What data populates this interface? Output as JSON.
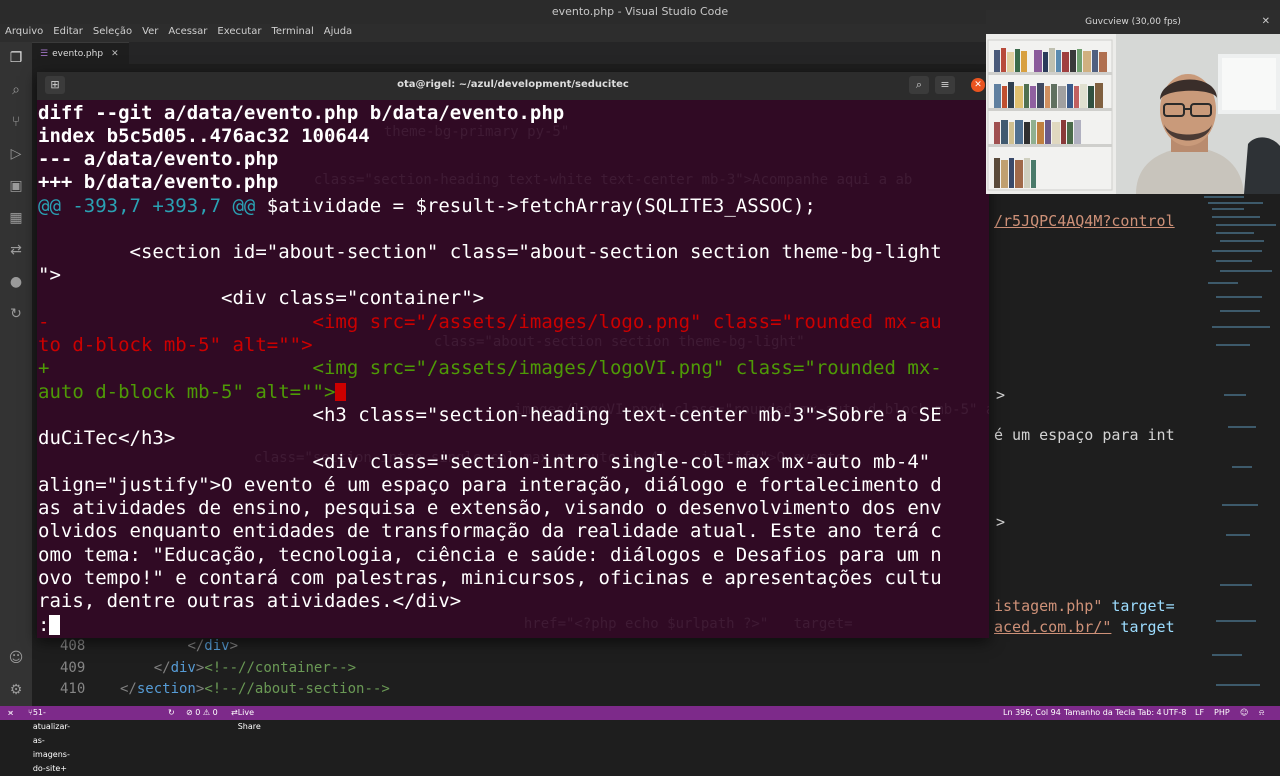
{
  "window": {
    "title": "evento.php - Visual Studio Code"
  },
  "menu": [
    "Arquivo",
    "Editar",
    "Seleção",
    "Ver",
    "Acessar",
    "Executar",
    "Terminal",
    "Ajuda"
  ],
  "tab": {
    "label": "evento.php"
  },
  "editor_lines": [
    {
      "num": "408",
      "indent": "        ",
      "code_open": "</",
      "tag": "div",
      "code_close": ">",
      "comment": ""
    },
    {
      "num": "409",
      "indent": "    ",
      "code_open": "</",
      "tag": "div",
      "code_close": ">",
      "comment": "<!--//container-->"
    },
    {
      "num": "410",
      "indent": "",
      "code_open": "</",
      "tag": "section",
      "code_close": ">",
      "comment": "<!--//about-section-->"
    }
  ],
  "editor_right": {
    "line1": "/r5JQPC4AQ4M?control",
    "line2": "é um espaço para int",
    "line3_a": "istagem.php\"",
    "line3_b": " target=",
    "line4_a": "aced.com.br/\"",
    "line4_b": " target"
  },
  "terminal": {
    "title": "ota@rigel: ~/azul/development/seducitec",
    "lines": {
      "l1": "diff --git a/data/evento.php b/data/evento.php",
      "l2": "index b5c5d05..476ac32 100644",
      "l3": "--- a/data/evento.php",
      "l4": "+++ b/data/evento.php",
      "l5a": "@@ -393,7 +393,7 @@",
      "l5b": " $atividade = $result->fetchArray(SQLITE3_ASSOC);",
      "l6": "        <section id=\"about-section\" class=\"about-section section theme-bg-light",
      "l7": "\">",
      "l8": "                <div class=\"container\">",
      "l9": "-                       <img src=\"/assets/images/logo.png\" class=\"rounded mx-au",
      "l10": "to d-block mb-5\" alt=\"\">",
      "l11a": "+",
      "l11b": "                       <img src=\"/assets/images/logoVI.png\" class=\"rounded mx-",
      "l12": "auto d-block mb-5\" alt=\"\">",
      "l13": "                        <h3 class=\"section-heading text-center mb-3\">Sobre a SE",
      "l14": "duCiTec</h3>",
      "l15": "                        <div class=\"section-intro single-col-max mx-auto mb-4\"",
      "l16": "align=\"justify\">O evento é um espaço para interação, diálogo e fortalecimento d",
      "l17": "as atividades de ensino, pesquisa e extensão, visando o desenvolvimento dos env",
      "l18": "olvidos enquanto entidades de transformação da realidade atual. Este ano terá c",
      "l19": "omo tema: \"Educação, tecnologia, ciência e saúde: diálogos e Desafios para um n",
      "l20": "ovo tempo!\" e contará com palestras, minicursos, oficinas e apresentações cultu",
      "l21": "rais, dentre outras atividades.</div>",
      "l22": ":"
    }
  },
  "webcam": {
    "title": "Guvcview  (30,00 fps)"
  },
  "status": {
    "branch": "51-atualizar-as-imagens-do-site+",
    "problems": "⊘ 0 ⚠ 0",
    "live_share": "Live Share",
    "position": "Ln 396, Col 94",
    "tab_size": "Tamanho da Tecla Tab: 4",
    "encoding": "UTF-8",
    "eol": "LF",
    "language": "PHP"
  },
  "colors": {
    "terminal_bg": "#300a24",
    "statusbar_bg": "#7d2a8a",
    "diff_add": "#4e9a06",
    "diff_del": "#cc0000",
    "hunk": "#2aa1b3"
  },
  "icons": [
    "files-icon",
    "search-icon",
    "source-control-icon",
    "run-debug-icon",
    "remote-explorer-icon",
    "extensions-icon",
    "live-share-icon",
    "github-icon",
    "timeline-icon",
    "account-icon",
    "settings-gear-icon"
  ]
}
